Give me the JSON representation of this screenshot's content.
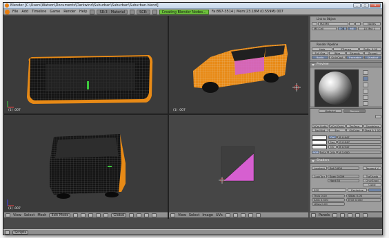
{
  "window": {
    "title": "Blender [C:\\Users\\Watson\\Documents\\Darkwind\\Suburban\\Suburban\\Suburban.blend]",
    "min": "_",
    "max": "□",
    "close": "x"
  },
  "infobar": {
    "menus": [
      "File",
      "Add",
      "Timeline",
      "Game",
      "Render",
      "Help"
    ],
    "screen": "SR:3 - Material",
    "scene": "SCE:",
    "status": "Creating Blender Nodes...",
    "stats": "Fa:867-3514 | Mem:23.18M (0.559M) 007"
  },
  "viewports": {
    "top_left_label": "(1) .007",
    "top_right_label": "(1) .007",
    "bottom_left_label": "(1) .007"
  },
  "view3d_header": {
    "menus": [
      "View",
      "Select",
      "Mesh"
    ],
    "mode": "Edit Mode",
    "pivot": "Global"
  },
  "uv_header": {
    "menus": [
      "View",
      "Select",
      "Image",
      "UVs"
    ]
  },
  "buttons_header": {
    "menu": "Panels"
  },
  "taskbar": {
    "menu": "Scripts"
  },
  "link_panel": {
    "header": "Link to Object",
    "material_name": "MA:Mtl",
    "nodes_label": "Nodes",
    "me_label": "ME:Cell",
    "fields": [
      "OB",
      "ME"
    ],
    "mat_count": "10 Mat 1"
  },
  "render_pipeline": {
    "header": "Render Pipeline",
    "row1": [
      "Halo",
      "ZTransp",
      "Zoffs: 0.00"
    ],
    "row2": [
      "Full Osa",
      "Wire",
      "Strands",
      "Zinvert"
    ],
    "row3": [
      "Radio",
      "OnlyCast",
      "Traceable",
      "Shadbuf"
    ]
  },
  "preview": {
    "header": "Preview"
  },
  "material": {
    "tabs": [
      "Material",
      "Ramps"
    ],
    "row1": [
      "VCol Light",
      "VCol Paint",
      "TexFace",
      "Shadeless"
    ],
    "row2": [
      "No Mist",
      "Env",
      "ObColor",
      "Shad A 1.00"
    ],
    "sliders": [
      {
        "label": "Col",
        "value": "R 0.947"
      },
      {
        "label": "Spe",
        "value": "G 0.947"
      },
      {
        "label": "Mir",
        "value": "B 0.947"
      }
    ],
    "model_buttons": [
      "RGB",
      "HSV",
      "DYN"
    ],
    "alpha": "A 1.000"
  },
  "shaders": {
    "header": "Shaders",
    "diffuse_model": "Lambert",
    "ref": "Ref 0.800",
    "spec_model": "Tangent V",
    "specular_model": "CookTorr",
    "spec": "Spec 0.009",
    "hard": "Hard:50",
    "toggles": [
      "TraShado",
      "OnlyShad",
      "Cubic"
    ],
    "sss_label": "SSS",
    "exclusive": "Exclusive",
    "translu": "Tralu 0.00",
    "sbias": "SBias 0.00",
    "amb": "Amb 0.500",
    "emit": "Emit 0.000",
    "lbias": "LBias 0.00"
  },
  "colors": {
    "mesh_orange": "#e88a16",
    "mesh_black": "#0c0c0c",
    "uv_face": "#d65fd0",
    "status_flag": "#6ec43c",
    "viewport_bg": "#3b3b3b"
  }
}
